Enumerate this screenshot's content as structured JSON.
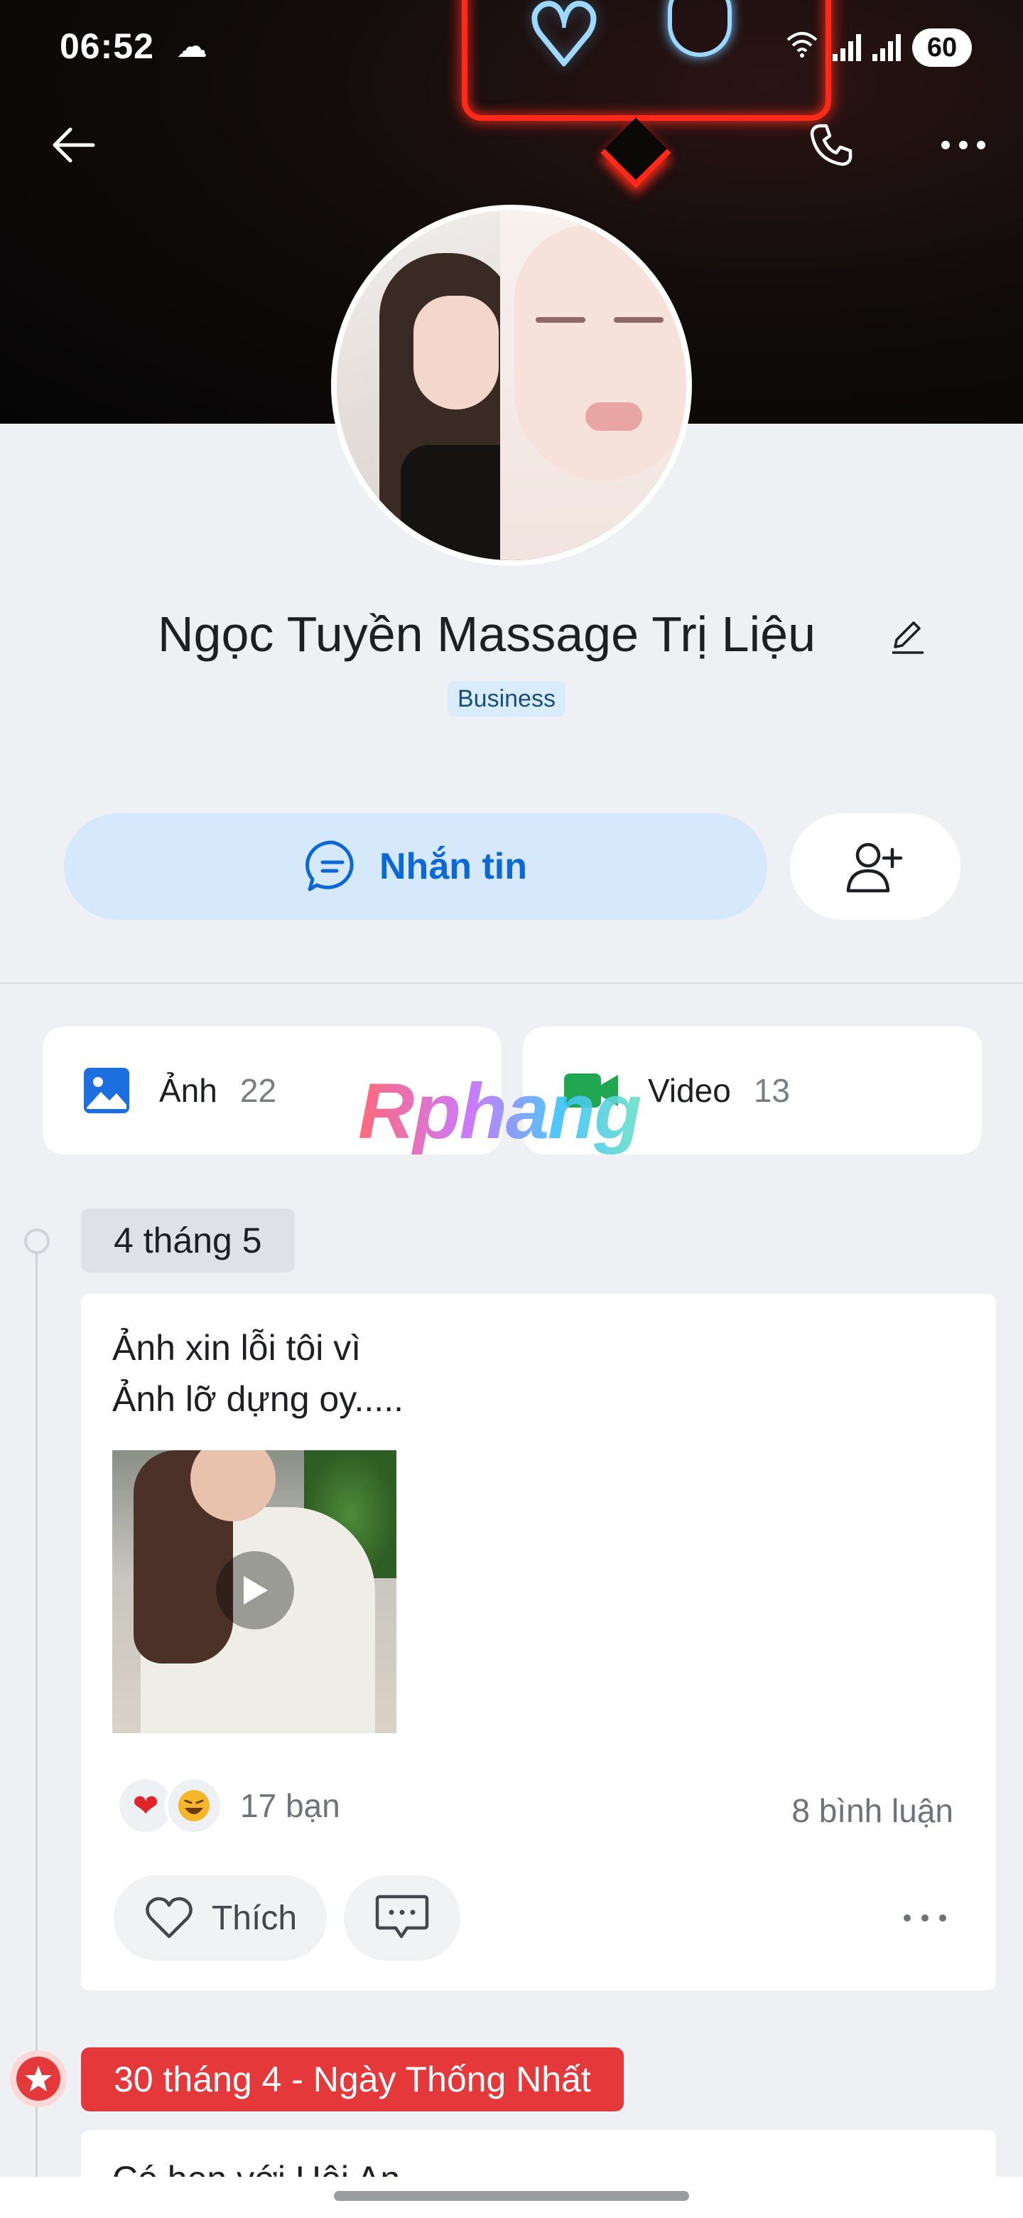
{
  "status_bar": {
    "time": "06:52",
    "battery": "60",
    "icons": [
      "weather-cloud-icon",
      "wifi-icon",
      "signal-icon",
      "signal-icon",
      "battery-icon"
    ]
  },
  "nav": {
    "icons": [
      "back-arrow-icon",
      "phone-icon",
      "more-icon"
    ]
  },
  "profile": {
    "name": "Ngọc Tuyền Massage Trị Liệu",
    "badge": "Business"
  },
  "actions": {
    "message_label": "Nhắn tin",
    "message_icon": "chat-bubble-icon",
    "add_friend_icon": "add-user-icon"
  },
  "media": {
    "photos": {
      "label": "Ảnh",
      "count": "22"
    },
    "videos": {
      "label": "Video",
      "count": "13"
    }
  },
  "watermark": "Rphang",
  "timeline": [
    {
      "date": "4 tháng 5",
      "text": "Ảnh xin lỗi tôi vì\nẢnh lỡ dựng oy.....",
      "reactions": [
        "heart",
        "laugh"
      ],
      "reaction_count": "17 bạn",
      "comment_count": "8 bình luận",
      "like_label": "Thích"
    },
    {
      "date": "30 tháng 4 - Ngày Thống Nhất",
      "text": "Có hẹn với Hội An"
    }
  ],
  "colors": {
    "accent": "#0c68d6",
    "message_bg": "#d6e8fc",
    "holiday": "#e5383b",
    "page_bg": "#eef0f3"
  }
}
